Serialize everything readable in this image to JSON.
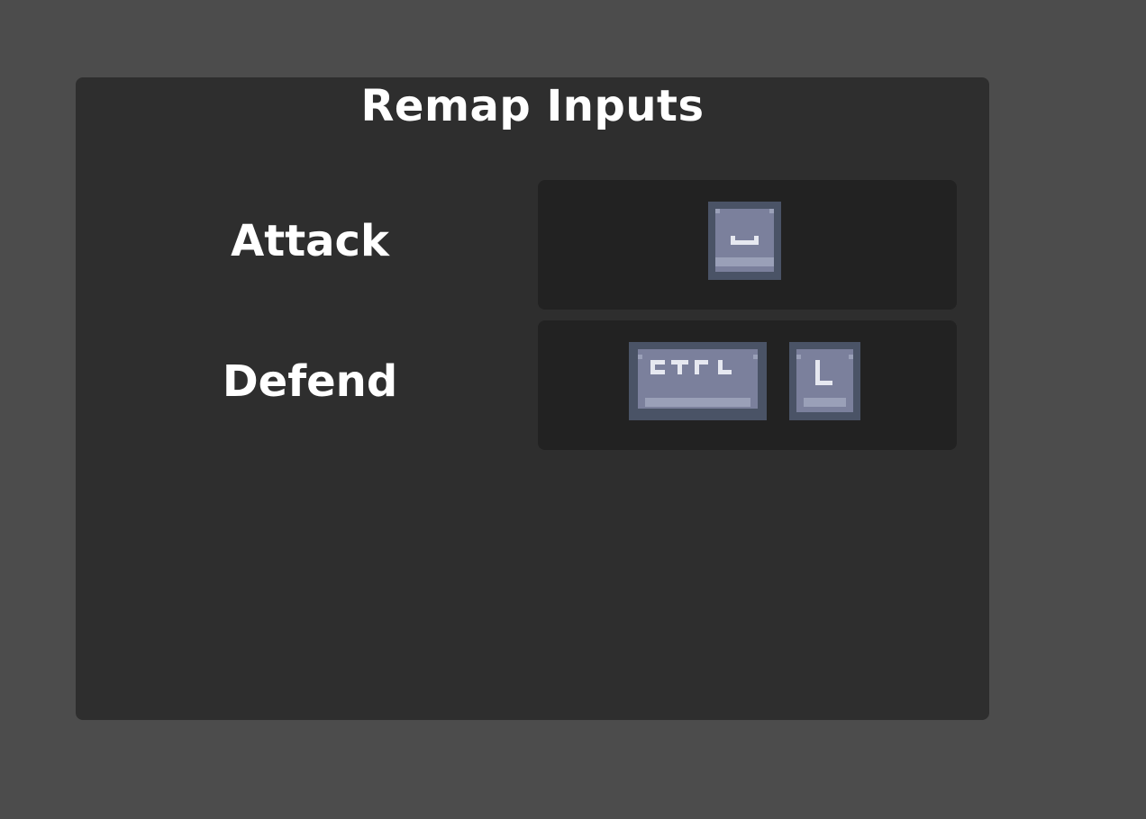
{
  "dialog": {
    "title": "Remap Inputs"
  },
  "bindings": [
    {
      "action": "Attack",
      "keys": [
        {
          "icon": "space-key-icon"
        }
      ]
    },
    {
      "action": "Defend",
      "keys": [
        {
          "icon": "ctrl-key-icon",
          "glyph": "CTRL"
        },
        {
          "icon": "l-key-icon",
          "glyph": "L"
        }
      ]
    }
  ],
  "colors": {
    "background": "#4c4c4c",
    "panel": "#2e2e2e",
    "slot": "#222222",
    "keycap_border": "#4a5366",
    "keycap_face": "#7b809c",
    "keycap_highlight": "#9aa0b8",
    "keycap_glyph": "#e6e8f0"
  }
}
